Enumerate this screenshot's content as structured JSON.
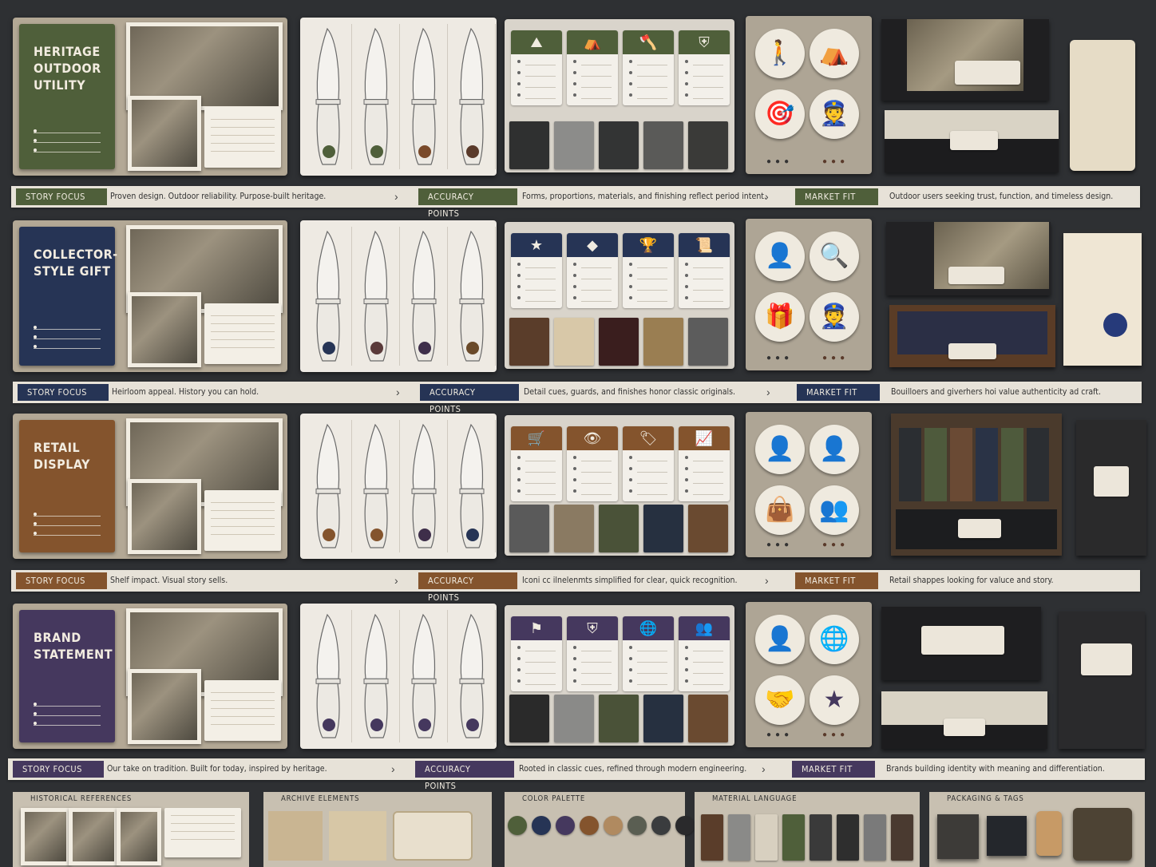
{
  "rows": [
    {
      "title": "HERITAGE OUTDOOR UTILITY",
      "color": "#4f5f3a",
      "story_label": "STORY FOCUS",
      "story_text": "Proven design. Outdoor reliability. Purpose-built heritage.",
      "accuracy_label": "ACCURACY POINTS",
      "accuracy_text": "Forms, proportions, materials, and finishing reflect period intent.",
      "market_label": "MARKET FIT",
      "market_text": "Outdoor users seeking trust, function, and timeless design.",
      "chip_icons": [
        "mountain-icon",
        "tent-icon",
        "axe-icon",
        "shield-icon"
      ],
      "chip_glyphs": [
        "⛰",
        "⛺",
        "🪓",
        "⛨"
      ],
      "circle_icons": [
        "hiker-icon",
        "dome-tent-icon",
        "hunter-icon",
        "ranger-icon"
      ],
      "circle_glyphs": [
        "🚶",
        "⛺",
        "🎯",
        "👮"
      ],
      "knife_dots": [
        "#4f5f3a",
        "#4f5f3a",
        "#7a4a2a",
        "#5a3a2a"
      ],
      "swatches": [
        "#2f3030",
        "#8c8c8a",
        "#333434",
        "#5a5a58",
        "#3a3a38"
      ]
    },
    {
      "title": "COLLECTOR-STYLE GIFT",
      "color": "#263455",
      "story_label": "STORY FOCUS",
      "story_text": "Heirloom appeal. History you can hold.",
      "accuracy_label": "ACCURACY POINTS",
      "accuracy_text": "Detail cues, guards, and finishes honor classic originals.",
      "market_label": "MARKET FIT",
      "market_text": "Bouilloers and giverhers hoi value authenticity ad craft.",
      "chip_icons": [
        "star-icon",
        "diamond-icon",
        "trophy-icon",
        "certificate-icon"
      ],
      "chip_glyphs": [
        "★",
        "◆",
        "🏆",
        "📜"
      ],
      "circle_icons": [
        "collector-icon",
        "inspector-icon",
        "gift-icon",
        "officer-icon"
      ],
      "circle_glyphs": [
        "👤",
        "🔍",
        "🎁",
        "👮"
      ],
      "knife_dots": [
        "#263455",
        "#5a3a3a",
        "#3e2e4a",
        "#6a4a2a"
      ],
      "swatches": [
        "#5a3d2a",
        "#d8c8a8",
        "#3a1e1e",
        "#9a7e52",
        "#5c5c5c"
      ]
    },
    {
      "title": "RETAIL DISPLAY",
      "color": "#84542d",
      "story_label": "STORY FOCUS",
      "story_text": "Shelf impact. Visual story sells.",
      "accuracy_label": "ACCURACY POINTS",
      "accuracy_text": "Iconi cc ilnelenmts simplified for clear, quick recognition.",
      "market_label": "MARKET FIT",
      "market_text": "Retail shappes looking for valuce and story.",
      "chip_icons": [
        "cart-icon",
        "eye-icon",
        "tag-icon",
        "growth-chart-icon"
      ],
      "chip_glyphs": [
        "🛒",
        "👁",
        "🏷",
        "📈"
      ],
      "circle_icons": [
        "customer-icon",
        "shopper-icon",
        "shopping-bag-icon",
        "group-icon"
      ],
      "circle_glyphs": [
        "👤",
        "👤",
        "👜",
        "👥"
      ],
      "knife_dots": [
        "#84542d",
        "#84542d",
        "#3e2e4a",
        "#263455"
      ],
      "swatches": [
        "#5a5a5a",
        "#8a7a62",
        "#4a5238",
        "#263040",
        "#6a4a30"
      ]
    },
    {
      "title": "BRAND STATEMENT",
      "color": "#45385e",
      "story_label": "STORY FOCUS",
      "story_text": "Our take on tradition. Built for today, inspired by heritage.",
      "accuracy_label": "ACCURACY POINTS",
      "accuracy_text": "Rooted in classic cues, refined through modern engineering.",
      "market_label": "MARKET FIT",
      "market_text": "Brands building identity with meaning and differentiation.",
      "chip_icons": [
        "flag-icon",
        "shield-icon",
        "globe-icon",
        "team-icon"
      ],
      "chip_glyphs": [
        "⚑",
        "⛨",
        "🌐",
        "👥"
      ],
      "circle_icons": [
        "businessman-icon",
        "globe-icon",
        "handshake-icon",
        "star-icon"
      ],
      "circle_glyphs": [
        "👤",
        "🌐",
        "🤝",
        "★"
      ],
      "knife_dots": [
        "#45385e",
        "#45385e",
        "#45385e",
        "#45385e"
      ],
      "swatches": [
        "#2a2a2a",
        "#8a8a88",
        "#4a5238",
        "#263040",
        "#6a4a30"
      ]
    }
  ],
  "bottom": {
    "historical": "HISTORICAL REFERENCES",
    "archive": "ARCHIVE ELEMENTS",
    "palette": "COLOR PALETTE",
    "material": "MATERIAL LANGUAGE",
    "packaging": "PACKAGING & TAGS",
    "palette_colors": [
      "#4f5f3a",
      "#263455",
      "#45385e",
      "#84542d",
      "#b08a60",
      "#5a5e52",
      "#3a3c3e",
      "#2a2a2c"
    ],
    "material_colors": [
      "#5a3d2a",
      "#8a8a88",
      "#d8d0c0",
      "#4f5f3a",
      "#3a3a3a",
      "#2e2e2e",
      "#7a7a7a",
      "#4a3a30"
    ]
  }
}
